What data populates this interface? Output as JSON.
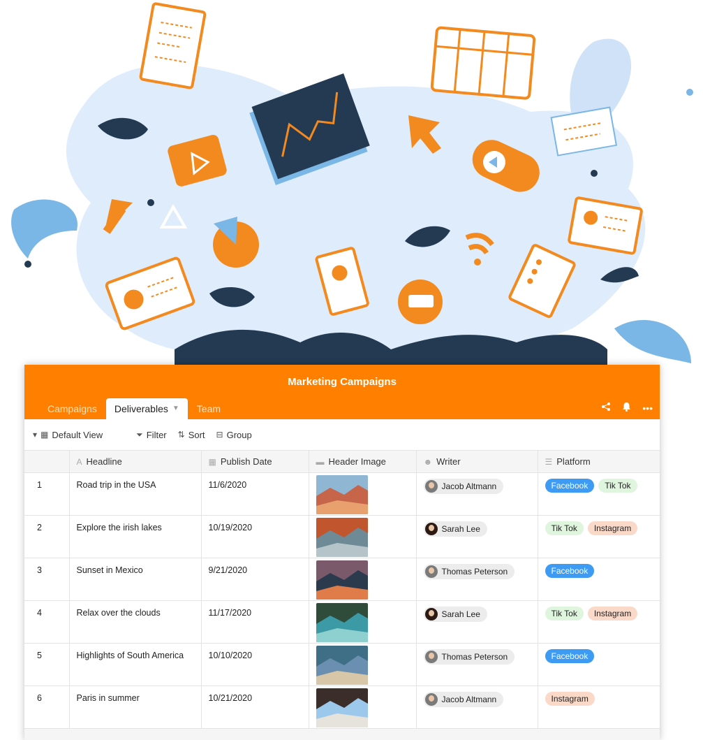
{
  "app": {
    "title": "Marketing Campaigns",
    "accent": "#ff8000"
  },
  "tabs": [
    {
      "label": "Campaigns",
      "active": false
    },
    {
      "label": "Deliverables",
      "active": true
    },
    {
      "label": "Team",
      "active": false
    }
  ],
  "top_icons": [
    "share-icon",
    "bell-icon",
    "more-icon"
  ],
  "toolbar": {
    "view_label": "Default View",
    "filter_label": "Filter",
    "sort_label": "Sort",
    "group_label": "Group"
  },
  "columns": [
    {
      "label": "Headline",
      "icon": "text-icon"
    },
    {
      "label": "Publish Date",
      "icon": "calendar-icon"
    },
    {
      "label": "Header Image",
      "icon": "image-icon"
    },
    {
      "label": "Writer",
      "icon": "people-icon"
    },
    {
      "label": "Platform",
      "icon": "list-icon"
    }
  ],
  "rows": [
    {
      "index": "1",
      "headline": "Road trip in the USA",
      "date": "11/6/2020",
      "writer": "Jacob Altmann",
      "platforms": [
        "Facebook",
        "Tik Tok"
      ]
    },
    {
      "index": "2",
      "headline": "Explore the irish lakes",
      "date": "10/19/2020",
      "writer": "Sarah Lee",
      "platforms": [
        "Tik Tok",
        "Instagram"
      ]
    },
    {
      "index": "3",
      "headline": "Sunset in Mexico",
      "date": "9/21/2020",
      "writer": "Thomas Peterson",
      "platforms": [
        "Facebook"
      ]
    },
    {
      "index": "4",
      "headline": "Relax over the clouds",
      "date": "11/17/2020",
      "writer": "Sarah Lee",
      "platforms": [
        "Tik Tok",
        "Instagram"
      ]
    },
    {
      "index": "5",
      "headline": "Highlights of South America",
      "date": "10/10/2020",
      "writer": "Thomas Peterson",
      "platforms": [
        "Facebook"
      ]
    },
    {
      "index": "6",
      "headline": "Paris in summer",
      "date": "10/21/2020",
      "writer": "Jacob Altmann",
      "platforms": [
        "Instagram"
      ]
    }
  ],
  "tag_colors": {
    "Facebook": "#3d9bf4",
    "Tik Tok": "#dff5de",
    "Instagram": "#fbd9c8"
  }
}
